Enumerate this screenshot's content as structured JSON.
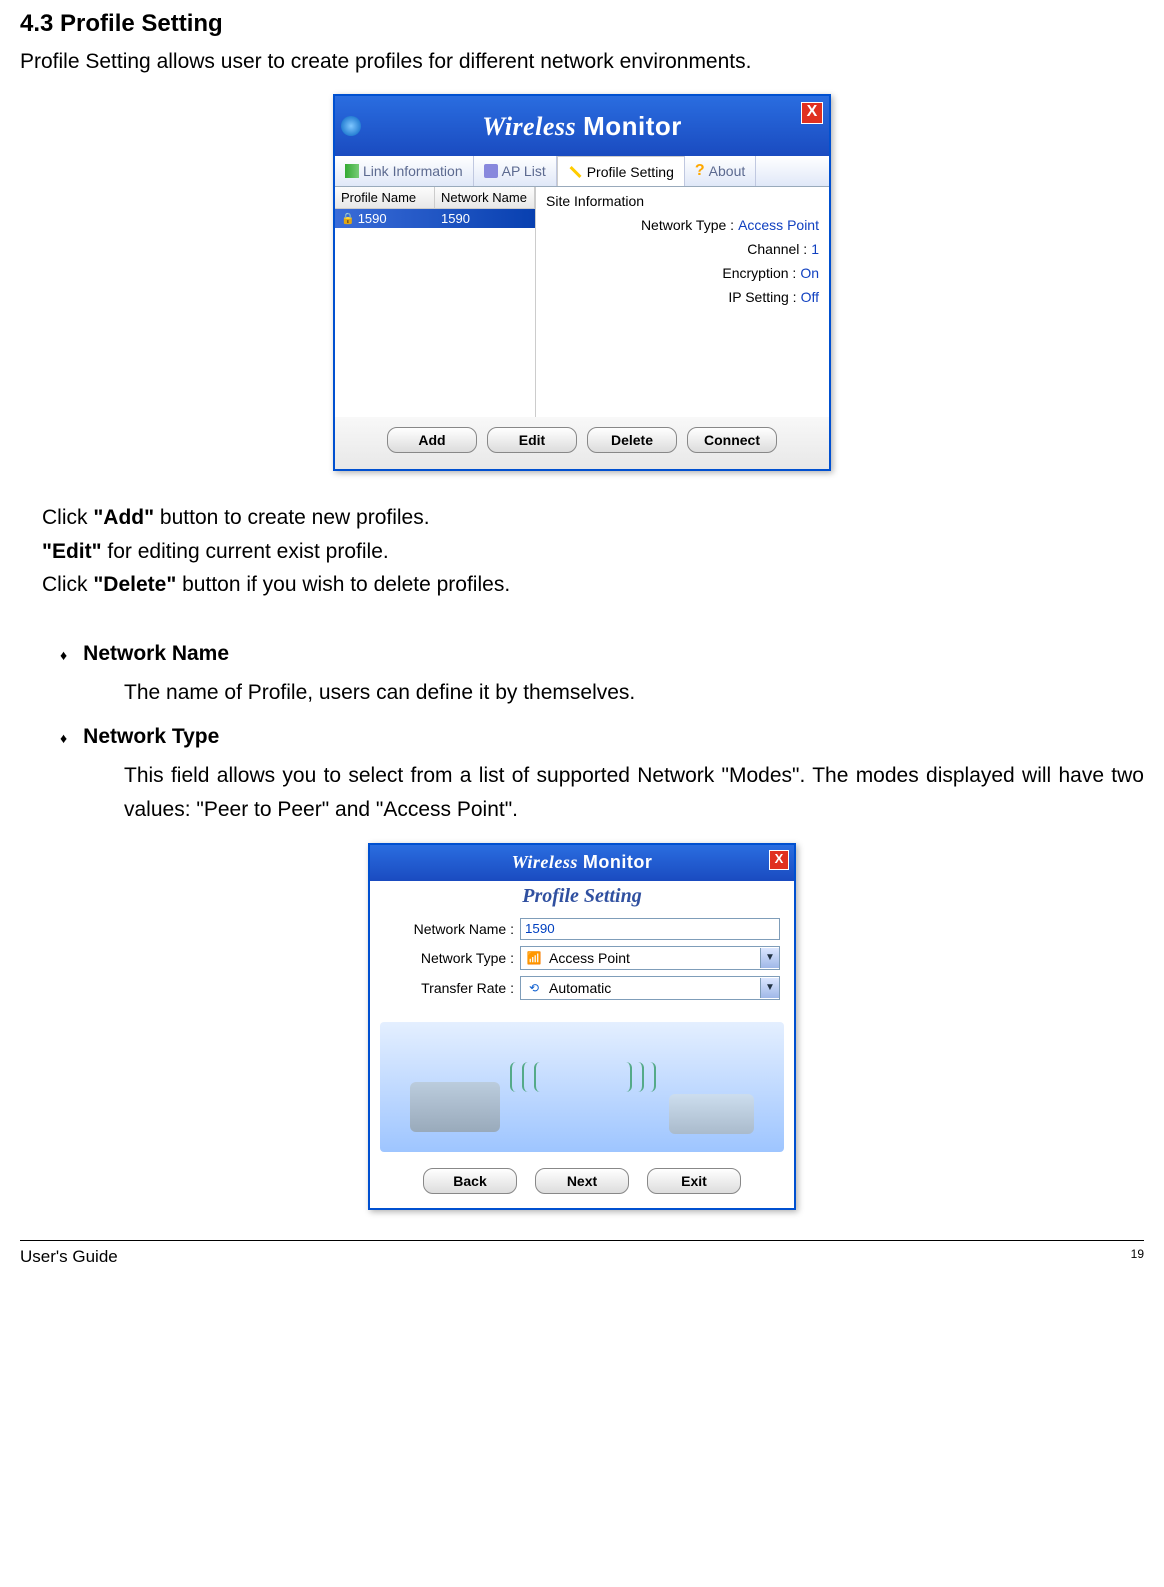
{
  "section": {
    "title": "4.3 Profile Setting",
    "intro": "Profile Setting allows user to create profiles for different network environments."
  },
  "app1": {
    "titlebar_wireless": "Wireless ",
    "titlebar_monitor": "Monitor",
    "close": "X",
    "tabs": {
      "link_info": "Link Information",
      "ap_list": "AP List",
      "profile_setting": "Profile Setting",
      "about": "About"
    },
    "headers": {
      "profile_name": "Profile Name",
      "network_name": "Network Name"
    },
    "row": {
      "profile": "1590",
      "network": "1590"
    },
    "panel_title": "Site Information",
    "info": {
      "network_type_label": "Network Type :",
      "network_type_value": "Access Point",
      "channel_label": "Channel :",
      "channel_value": "1",
      "encryption_label": "Encryption :",
      "encryption_value": "On",
      "ip_label": "IP Setting :",
      "ip_value": "Off"
    },
    "buttons": {
      "add": "Add",
      "edit": "Edit",
      "delete": "Delete",
      "connect": "Connect"
    }
  },
  "notes": {
    "l1a": "Click ",
    "l1b": "\"Add\"",
    "l1c": " button to create new profiles.",
    "l2a": "\"Edit\"",
    "l2b": " for editing current exist profile.",
    "l3a": "Click ",
    "l3b": "\"Delete\"",
    "l3c": " button if you wish to delete profiles."
  },
  "bullets": {
    "nn_title": "Network Name",
    "nn_desc": "The name of Profile, users can define it by themselves.",
    "nt_title": "Network Type",
    "nt_desc": "This field allows you to select from a list of supported Network \"Modes\". The modes displayed will have two values:   \"Peer to Peer\" and \"Access Point\"."
  },
  "app2": {
    "titlebar_wireless": "Wireless ",
    "titlebar_monitor": "Monitor",
    "close": "X",
    "subtitle": "Profile Setting",
    "labels": {
      "network_name": "Network Name :",
      "network_type": "Network Type :",
      "transfer_rate": "Transfer Rate :"
    },
    "values": {
      "network_name": "1590",
      "network_type": "Access Point",
      "transfer_rate": "Automatic"
    },
    "buttons": {
      "back": "Back",
      "next": "Next",
      "exit": "Exit"
    }
  },
  "footer": {
    "guide": "User's Guide",
    "page": "19"
  }
}
